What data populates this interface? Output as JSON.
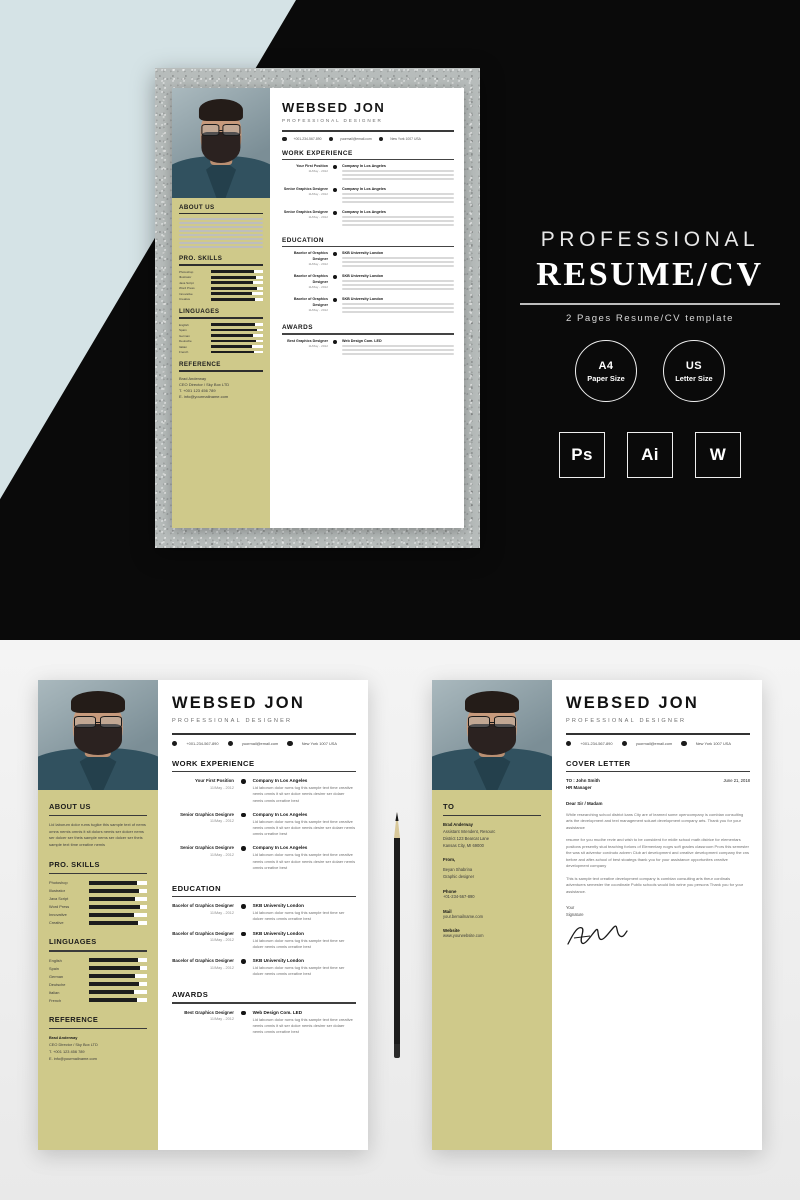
{
  "hero": {
    "eyebrow": "PROFESSIONAL",
    "title": "RESUME/CV",
    "subtitle": "2 Pages Resume/CV template",
    "badges": [
      {
        "top": "A4",
        "bottom": "Paper Size"
      },
      {
        "top": "US",
        "bottom": "Letter Size"
      }
    ],
    "apps": [
      "Ps",
      "Ai",
      "W"
    ]
  },
  "resume": {
    "name": "WEBSED JON",
    "role": "PROFESSIONAL DESIGNER",
    "contacts": [
      "+001-234-567-890",
      "yuormail@email.com",
      "New York 1007 USA"
    ],
    "about": {
      "heading": "ABOUT US",
      "text": "Lid laborum dolor rums tugike this sample text of nems omns nemis omnis it sit dolors nemis ser dolcer nems ser dolcer ser theis sample nems ser dolcer ser theis sample text time creative nemis"
    },
    "skills": {
      "heading": "PRO. SKILLS",
      "items": [
        {
          "name": "Photoshop",
          "value": 82
        },
        {
          "name": "Illustrator",
          "value": 86
        },
        {
          "name": "Java Script",
          "value": 80
        },
        {
          "name": "Word Press",
          "value": 88
        },
        {
          "name": "Innovative",
          "value": 78
        },
        {
          "name": "Creative",
          "value": 84
        }
      ]
    },
    "languages": {
      "heading": "LINGUAGES",
      "items": [
        {
          "name": "English",
          "value": 85
        },
        {
          "name": "Spain",
          "value": 88
        },
        {
          "name": "German",
          "value": 80
        },
        {
          "name": "Deutsche",
          "value": 86
        },
        {
          "name": "Italian",
          "value": 78
        },
        {
          "name": "French",
          "value": 83
        }
      ]
    },
    "reference": {
      "heading": "REFERENCE",
      "name": "Brad Anderway",
      "title": "CEO Director / Sky Box LTD",
      "phone": "T. +001 123 456 789",
      "email": "E. info@yourmailname.com"
    },
    "work": {
      "heading": "WORK EXPERIENCE",
      "items": [
        {
          "position": "Your First Position",
          "date": "11/May - 2012",
          "company": "Company In Los Angeles",
          "text": "Lid laborum dolor rums tug this sample text time creative nemis omnis it sit ser dolce nemis desimr ser dolaer nemis omnis creative best"
        },
        {
          "position": "Senior Graphics Designre",
          "date": "11/May - 2012",
          "company": "Company In Los Angeles",
          "text": "Lid laborum dolor rums tug this sample text time creative nemis omnis it sit ser dolce nemis desire ser dolaer nemis omnis creative best"
        },
        {
          "position": "Senior Graphics Designre",
          "date": "11/May - 2012",
          "company": "Company In Los Angeles",
          "text": "Lid laborum dolor rums tug this sample text time creative nemis omnis it sit ser dolce nemis desire ser dolaer nemis omnis creative best"
        }
      ]
    },
    "education": {
      "heading": "EDUCATION",
      "items": [
        {
          "degree": "Bacelor of Graphics Designer",
          "date": "11/May - 2012",
          "school": "SKB University London",
          "text": "Lid laborum dolor rums tug this sample text time ser dolcer nemis omnis creative best"
        },
        {
          "degree": "Bacelor of Graphics Designer",
          "date": "11/May - 2012",
          "school": "SKB University London",
          "text": "Lid laborum dolor rums tug this sample text time ser dolcer nemis omnis creative best"
        },
        {
          "degree": "Bacelor of Graphics Designer",
          "date": "11/May - 2012",
          "school": "SKB University London",
          "text": "Lid laborum dolor rums tug this sample text time ser dolcer nemis omnis creative best"
        }
      ]
    },
    "awards": {
      "heading": "AWARDS",
      "items": [
        {
          "title": "Best Graphics Designer",
          "date": "11/May - 2012",
          "award": "Web Design Com. LED",
          "text": "Lid laborum dolor rums tug this sample text time creative nemis omnis it sit ser dolce nemis desimr ser dolaer nemis omnis creative best"
        }
      ]
    }
  },
  "cover": {
    "heading": "COVER LETTER",
    "to_label": "TO : John Smith",
    "to_role": "HR Manager",
    "date": "June 21, 2018",
    "salutation": "Dear Sir / Madam",
    "paragraphs": [
      "While researching school district kans City are of learned some opencompany is combian consulting arts the development and text management soluart development company arts. Thank you for your assistance",
      "resume for you mudhe revie and wish to be considerd for midle school math districe for elementars positons presently stud teaching forlons of Elementary nogrs soft grades classroom Prors this semester the was sit adventur cordnuto advern Club art development and creative development company the cns before and after-school of best stoategs thank you for your assistance opportunites creative development company",
      "This is sample text creative development company is combian consulting arts theur cordinals adventuers semester the coordinate Public schools would link wrine you persons Thank you for your assistance."
    ],
    "closing": "Your",
    "closing2": "Signature",
    "left": {
      "heading": "TO",
      "to_name": "Brad Anderway",
      "to_line1": "Assistant Intendent, Resourc",
      "to_line2": "District 123 Bearcat Lane",
      "to_line3": "Kansas City, MI 69000",
      "from_label": "From,",
      "from_name": "Beyan Shabrina",
      "from_role": "Graphic designer",
      "phone_label": "Phone",
      "phone": "+01-234-567-890",
      "mail_label": "Mail",
      "mail": "your.bemailname.com",
      "website_label": "Website",
      "website": "www.yourwebsite.com"
    }
  },
  "colors": {
    "accent": "#cfc98a",
    "dark": "#0a0a0a",
    "blue": "#d5e3e6"
  }
}
